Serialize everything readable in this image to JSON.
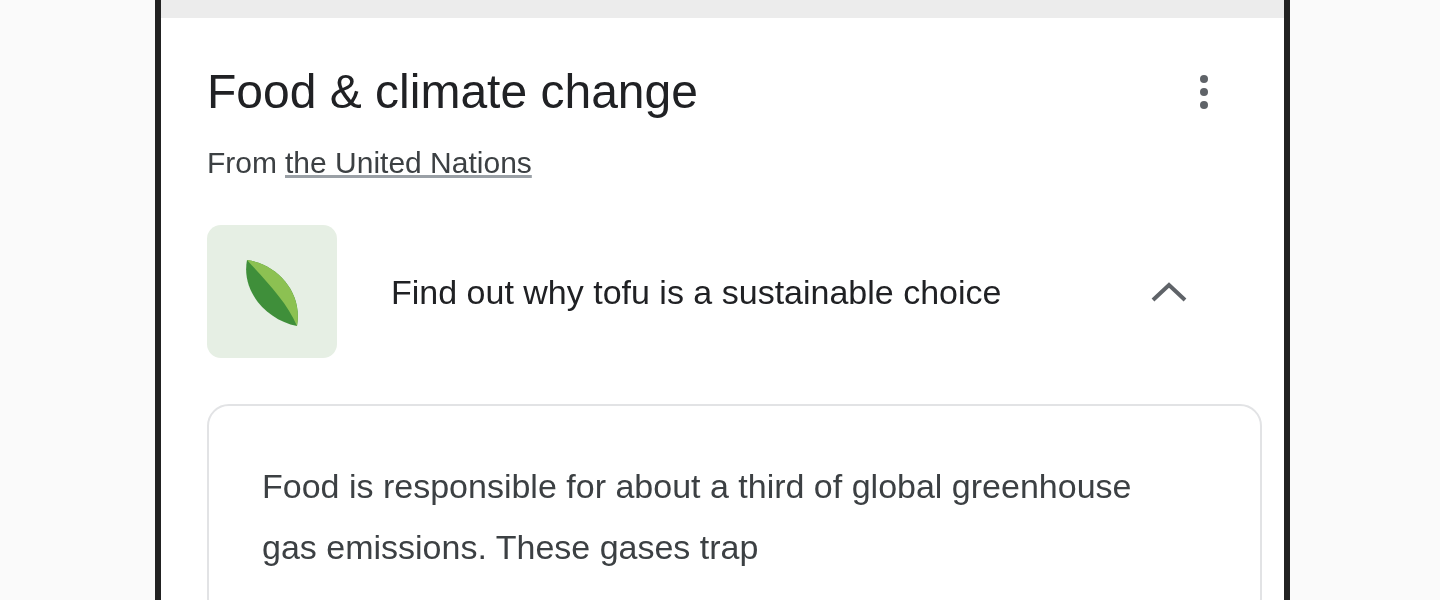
{
  "card": {
    "title": "Food & climate change",
    "source_prefix": "From",
    "source_link": "the United Nations",
    "items": [
      {
        "question": "Find out why tofu is a sustainable choice",
        "expanded": true,
        "answer": "Food is responsible for about a third of global greenhouse gas emissions. These gases trap"
      }
    ]
  }
}
